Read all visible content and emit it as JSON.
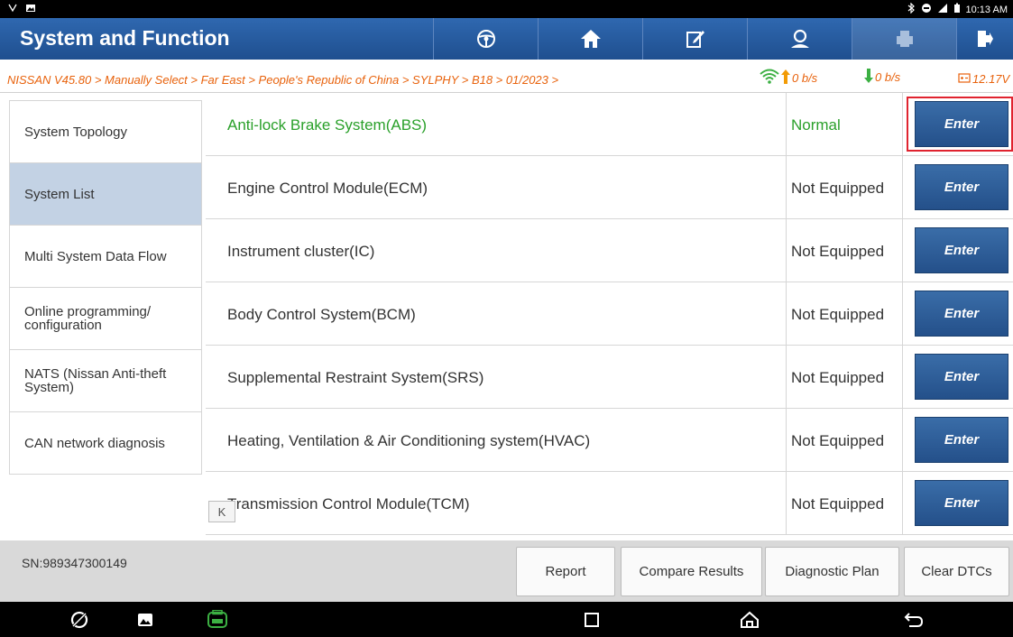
{
  "statusbar": {
    "time": "10:13 AM",
    "left_icons": [
      "usb-icon",
      "image-icon"
    ],
    "right_icons": [
      "bluetooth-icon",
      "do-not-disturb-icon",
      "signal-icon",
      "battery-icon"
    ]
  },
  "header": {
    "title": "System and Function",
    "toolbar_icons": [
      "steering-wheel-icon",
      "home-icon",
      "edit-icon",
      "user-icon",
      "print-icon",
      "exit-icon"
    ],
    "background_color": "#2a5c9e"
  },
  "breadcrumb": {
    "path": "NISSAN V45.80 > Manually Select > Far East > People's Republic of China > SYLPHY > B18 > 01/2023 >",
    "upload_rate": "0 b/s",
    "download_rate": "0 b/s",
    "voltage": "12.17V",
    "color": "#e8620c"
  },
  "sidebar": {
    "items": [
      {
        "label": "System Topology",
        "active": false
      },
      {
        "label": "System List",
        "active": true
      },
      {
        "label": "Multi System Data Flow",
        "active": false
      },
      {
        "label": "Online programming/\nconfiguration",
        "active": false
      },
      {
        "label": "NATS (Nissan Anti-theft\nSystem)",
        "active": false
      },
      {
        "label": "CAN network diagnosis",
        "active": false
      }
    ]
  },
  "systems": {
    "enter_label": "Enter",
    "rows": [
      {
        "name": "Anti-lock Brake System(ABS)",
        "status": "Normal",
        "highlighted": true
      },
      {
        "name": "Engine Control Module(ECM)",
        "status": "Not Equipped",
        "highlighted": false
      },
      {
        "name": "Instrument cluster(IC)",
        "status": "Not Equipped",
        "highlighted": false
      },
      {
        "name": "Body Control System(BCM)",
        "status": "Not Equipped",
        "highlighted": false
      },
      {
        "name": "Supplemental Restraint System(SRS)",
        "status": "Not Equipped",
        "highlighted": false
      },
      {
        "name": "Heating, Ventilation & Air Conditioning system(HVAC)",
        "status": "Not Equipped",
        "highlighted": false
      },
      {
        "name": "Transmission Control Module(TCM)",
        "status": "Not Equipped",
        "highlighted": false
      }
    ],
    "ok_color": "#2aa02a",
    "highlight_color": "#e0232f"
  },
  "collapse_glyph": "K",
  "footer": {
    "serial": "SN:989347300149",
    "buttons": [
      "Report",
      "Compare Results",
      "Diagnostic Plan",
      "Clear DTCs"
    ]
  },
  "navbar": {
    "icons": [
      "browser-icon",
      "gallery-icon",
      "vci-icon",
      "recents-icon",
      "home-icon",
      "back-icon"
    ]
  }
}
